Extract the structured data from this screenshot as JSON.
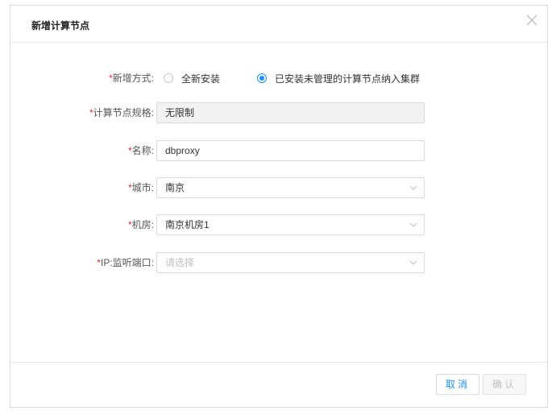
{
  "dialog": {
    "title": "新增计算节点",
    "close_icon": "close-icon"
  },
  "form": {
    "add_mode": {
      "required_mark": "*",
      "label": "新增方式:",
      "options": [
        {
          "label": "全新安装",
          "checked": false
        },
        {
          "label": "已安装未管理的计算节点纳入集群",
          "checked": true
        }
      ]
    },
    "spec": {
      "required_mark": "*",
      "label": "计算节点规格:",
      "value": "无限制"
    },
    "name": {
      "required_mark": "*",
      "label": "名称:",
      "value": "dbproxy"
    },
    "city": {
      "required_mark": "*",
      "label": "城市:",
      "value": "南京"
    },
    "room": {
      "required_mark": "*",
      "label": "机房:",
      "value": "南京机房1"
    },
    "ip_port": {
      "required_mark": "*",
      "label": "IP:监听端口:",
      "placeholder": "请选择"
    }
  },
  "footer": {
    "cancel_label": "取消",
    "confirm_label": "确认"
  },
  "colors": {
    "accent": "#1890ff",
    "required": "#f5222d",
    "disabled_bg": "#f2f2f2"
  }
}
